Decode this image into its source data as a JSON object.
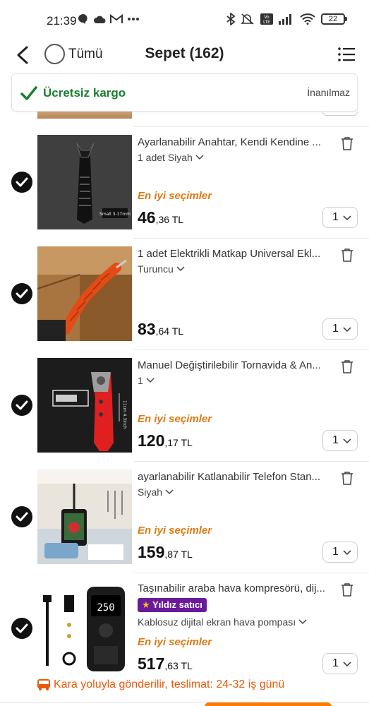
{
  "status_bar": {
    "time": "21:39",
    "left_icons": [
      "chat-icon",
      "cloud-icon",
      "gmail-icon",
      "more-icon"
    ],
    "right_icons": [
      "bluetooth-icon",
      "mute-icon",
      "volte-icon",
      "signal-icon",
      "wifi-icon",
      "battery-icon"
    ],
    "battery_level": "22"
  },
  "header": {
    "select_all_label": "Tümü",
    "title": "Sepet (162)"
  },
  "banner": {
    "title": "Ücretsiz kargo",
    "right_text": "İnanılmaz",
    "accent": "#1a7f2e"
  },
  "items": [
    {
      "title": "Ayarlanabilir Anahtar, Kendi Kendine ...",
      "variant": "1 adet Siyah",
      "best_choice": "En iyi seçimler",
      "price_int": "46",
      "price_dec": ",36 TL",
      "qty": "1"
    },
    {
      "title": "1 adet Elektrikli Matkap Universal Ekl...",
      "variant": "Turuncu",
      "best_choice": "",
      "price_int": "83",
      "price_dec": ",64 TL",
      "qty": "1"
    },
    {
      "title": "Manuel Değiştirilebilir Tornavida & An...",
      "variant": "1",
      "best_choice": "En iyi seçimler",
      "price_int": "120",
      "price_dec": ",17 TL",
      "qty": "1"
    },
    {
      "title": "ayarlanabilir Katlanabilir Telefon Stan...",
      "variant": "Siyah",
      "best_choice": "En iyi seçimler",
      "price_int": "159",
      "price_dec": ",87 TL",
      "qty": "1"
    },
    {
      "title": "Taşınabilir araba hava kompresörü, dij...",
      "seller_badge": "Yıldız satıcı",
      "variant": "Kablosuz dijital ekran hava pompası",
      "best_choice": "En iyi seçimler",
      "price_int": "517",
      "price_dec": ",63 TL",
      "qty": "1"
    }
  ],
  "image_text": {
    "item1_label": "Small 3-17mm",
    "item3_label": "11cm 4.3inch",
    "item5_display": "250"
  },
  "delivery_note": "Kara yoluyla gönderilir, teslimat: 24-32 iş günü",
  "colors": {
    "best_choice": "#e07a14",
    "delivery": "#e8590c",
    "seller_badge": "#6a1b9a"
  }
}
